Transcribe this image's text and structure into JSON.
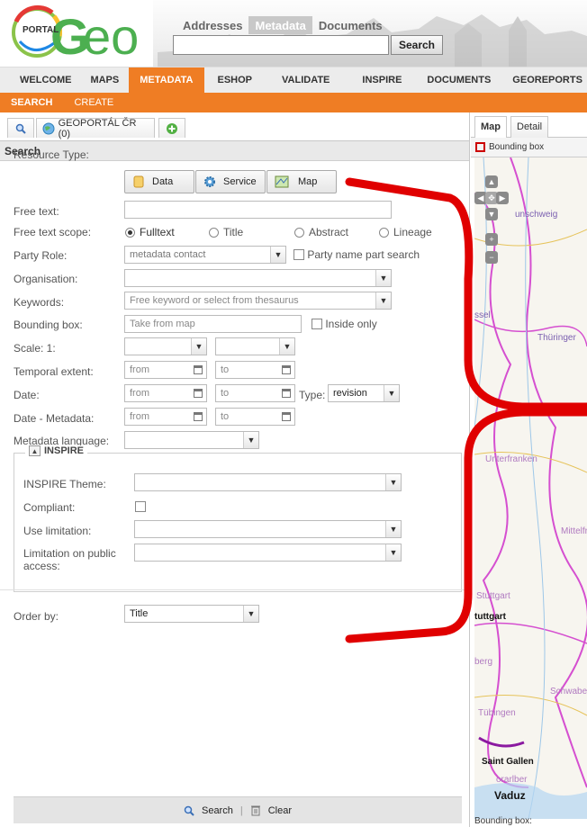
{
  "header": {
    "logo_small": "PORTAL",
    "logo_big": "Geo",
    "links": [
      "Addresses",
      "Metadata",
      "Documents"
    ],
    "search_button": "Search"
  },
  "nav": [
    "WELCOME",
    "MAPS",
    "METADATA",
    "ESHOP",
    "VALIDATE",
    "INSPIRE",
    "DOCUMENTS",
    "GEOREPORTS"
  ],
  "subnav": [
    "SEARCH",
    "CREATE"
  ],
  "tabs": {
    "catalog": "GEOPORTÁL ČR (0)"
  },
  "search": {
    "heading": "Search",
    "resource_type_label": "Resource Type:",
    "resource_buttons": [
      "Data",
      "Service",
      "Map"
    ],
    "free_text_label": "Free text:",
    "scope_label": "Free text scope:",
    "scope_options": [
      "Fulltext",
      "Title",
      "Abstract",
      "Lineage"
    ],
    "party_role_label": "Party Role:",
    "party_role_value": "metadata contact",
    "party_name_part": "Party name part search",
    "organisation_label": "Organisation:",
    "keywords_label": "Keywords:",
    "keywords_placeholder": "Free keyword or select from thesaurus",
    "bbox_label": "Bounding box:",
    "bbox_placeholder": "Take from map",
    "inside_only": "Inside only",
    "scale_label": "Scale: 1:",
    "temporal_label": "Temporal extent:",
    "date_label": "Date:",
    "date_meta_label": "Date - Metadata:",
    "from": "from",
    "to": "to",
    "type_label": "Type:",
    "type_value": "revision",
    "meta_lang_label": "Metadata language:",
    "inspire_legend": "INSPIRE",
    "inspire_theme_label": "INSPIRE Theme:",
    "compliant_label": "Compliant:",
    "use_limitation_label": "Use limitation:",
    "limitation_public_label": "Limitation on public access:",
    "order_by_label": "Order by:",
    "order_by_value": "Title",
    "search_action": "Search",
    "clear_action": "Clear"
  },
  "map": {
    "tabs": [
      "Map",
      "Detail"
    ],
    "bbox_tool": "Bounding box",
    "footer": "Bounding box:",
    "places": [
      "unschweig",
      "ssel",
      "Thüringer",
      "Unterfranken",
      "Mittelfr",
      "Stuttgart",
      "tuttgart",
      "berg",
      "Schwabe",
      "Tübingen",
      "Saint Gallen",
      "orarlber",
      "Vaduz"
    ]
  }
}
